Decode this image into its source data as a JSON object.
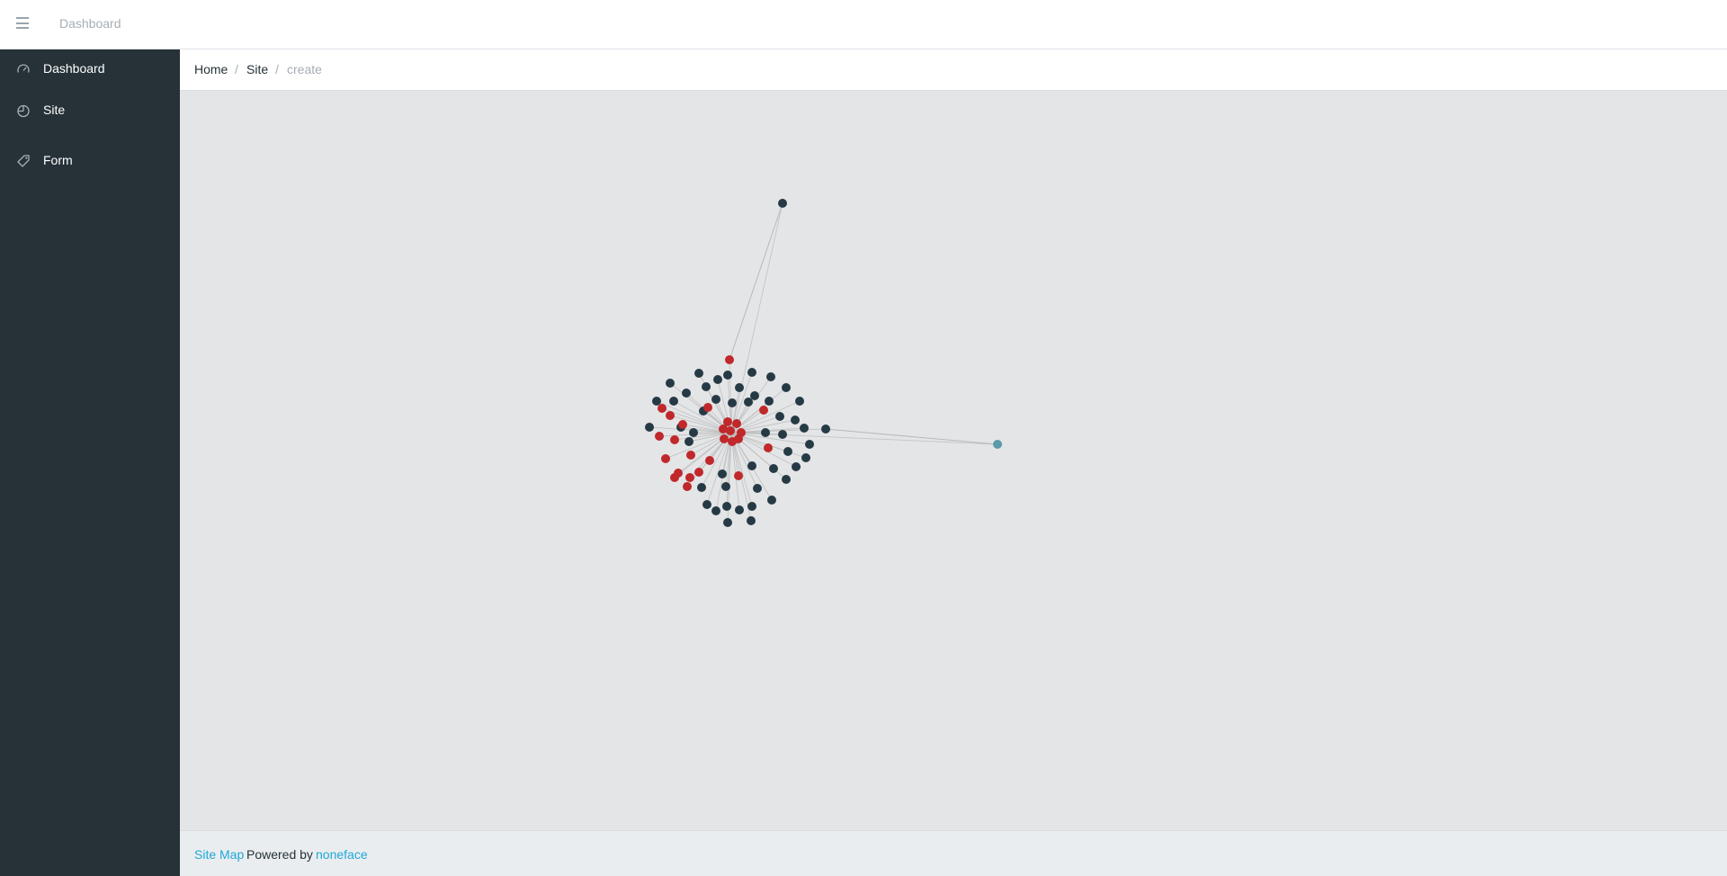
{
  "topbar": {
    "title": "Dashboard",
    "menu_icon": "hamburger-icon"
  },
  "sidebar": {
    "items": [
      {
        "label": "Dashboard",
        "icon": "speedometer-icon"
      },
      {
        "label": "Site",
        "icon": "pie-chart-icon"
      },
      {
        "label": "Form",
        "icon": "tag-icon"
      }
    ]
  },
  "breadcrumb": {
    "home": "Home",
    "site": "Site",
    "current": "create",
    "separator": "/"
  },
  "graph": {
    "colors": {
      "node_dark": "#263a45",
      "node_red": "#c0282b",
      "node_teal": "#5b9aa8",
      "edge": "#b9b9b9"
    },
    "hub_count": 8,
    "dark_nodes": 58,
    "red_nodes": 22,
    "teal_nodes": 1
  },
  "footer": {
    "sitemap": "Site Map",
    "powered": "Powered by",
    "author": "noneface"
  }
}
